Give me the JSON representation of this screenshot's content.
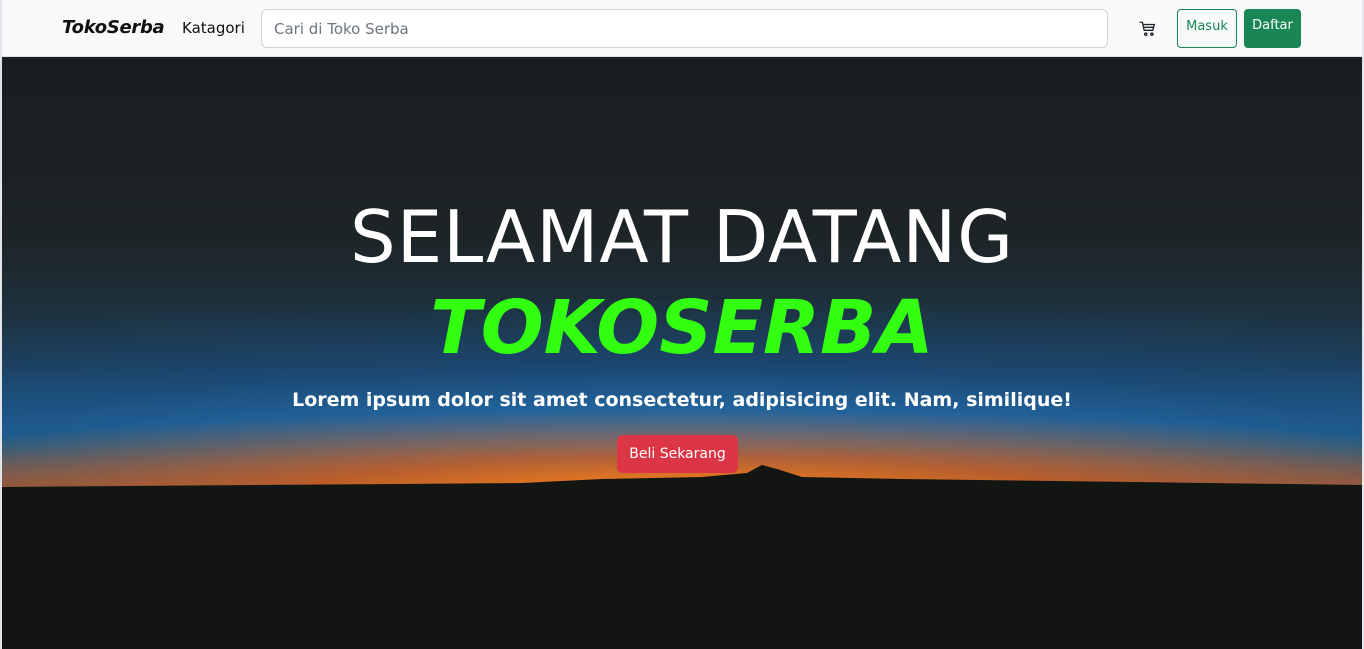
{
  "navbar": {
    "brand": "TokoSerba",
    "category_link": "Katagori",
    "search_placeholder": "Cari di Toko Serba",
    "cart_icon": "cart-icon",
    "login_label": "Masuk",
    "register_label": "Daftar"
  },
  "hero": {
    "title": "SELAMAT DATANG",
    "brand": "TOKOSERBA",
    "subtitle": "Lorem ipsum dolor sit amet consectetur, adipisicing elit. Nam, similique!",
    "cta_label": "Beli Sekarang"
  },
  "colors": {
    "brand_green": "#198754",
    "hero_brand_green": "#33ff11",
    "cta_red": "#dc3545"
  }
}
